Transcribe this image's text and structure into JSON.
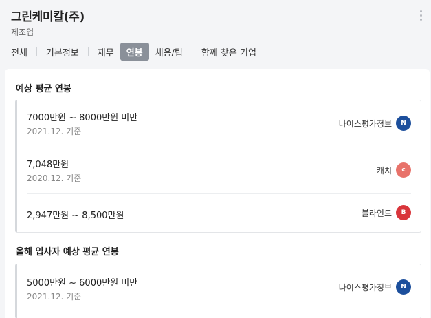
{
  "header": {
    "company_name": "그린케미칼(주)",
    "industry": "제조업"
  },
  "tabs": [
    {
      "label": "전체",
      "active": false
    },
    {
      "label": "기본정보",
      "active": false
    },
    {
      "label": "재무",
      "active": false
    },
    {
      "label": "연봉",
      "active": true
    },
    {
      "label": "채용/팁",
      "active": false
    },
    {
      "label": "함께 찾은 기업",
      "active": false
    }
  ],
  "salary": {
    "title": "예상 평균 연봉",
    "rows": [
      {
        "amount": "7000만원 ~ 8000만원 미만",
        "basis": "2021.12. 기준",
        "source": "나이스평가정보",
        "logo_icon": "nice-logo-icon"
      },
      {
        "amount": "7,048만원",
        "basis": "2020.12. 기준",
        "source": "캐치",
        "logo_icon": "catch-logo-icon"
      },
      {
        "amount": "2,947만원 ~ 8,500만원",
        "basis": "",
        "source": "블라인드",
        "logo_icon": "blind-logo-icon"
      }
    ]
  },
  "new_hire_salary": {
    "title": "올해 입사자 예상 평균 연봉",
    "rows": [
      {
        "amount": "5000만원 ~ 6000만원 미만",
        "basis": "2021.12. 기준",
        "source": "나이스평가정보",
        "logo_icon": "nice-logo-icon"
      }
    ]
  },
  "colors": {
    "active_tab": "#8a9099",
    "nice_logo": "#1c4f9c",
    "catch_logo": "#e8726a",
    "blind_logo": "#d9353b"
  }
}
